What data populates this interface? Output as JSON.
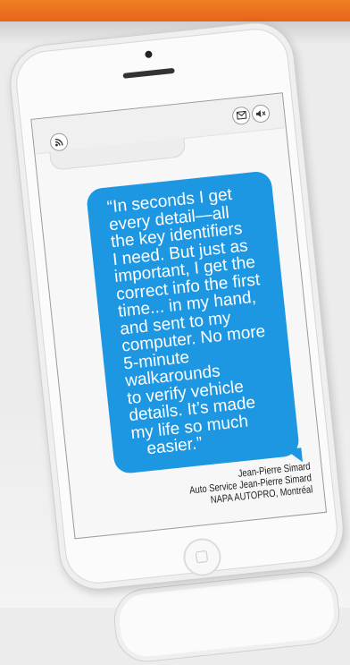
{
  "testimonial": {
    "quote_lines": [
      "“In seconds I get",
      "every detail—all",
      "the key identifiers",
      "I need. But just as",
      "important, I get the",
      "correct info the first",
      "time... in my hand,",
      "and sent to my",
      "computer. No more",
      "5-minute",
      "walkarounds",
      "to verify vehicle",
      "details. It’s made",
      "my life so much",
      "easier.”"
    ],
    "author_name": "Jean-Pierre Simard",
    "author_business": "Auto Service Jean-Pierre Simard",
    "author_location": "NAPA AUTOPRO, Montréal"
  },
  "status_icons": {
    "left": "rss-icon",
    "right": [
      "mail-icon",
      "mute-icon"
    ]
  },
  "colors": {
    "accent_orange": "#e8641a",
    "bubble_blue": "#1e97e2"
  }
}
